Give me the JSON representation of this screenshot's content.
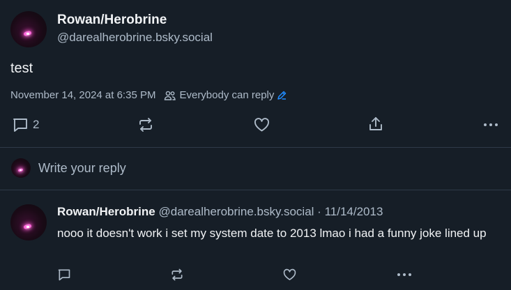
{
  "post": {
    "author_name": "Rowan/Herobrine",
    "author_handle": "@darealherobrine.bsky.social",
    "text": "test",
    "timestamp": "November 14, 2024 at 6:35 PM",
    "reply_setting": "Everybody can reply",
    "reply_count": "2"
  },
  "composer": {
    "placeholder": "Write your reply"
  },
  "reply": {
    "author_name": "Rowan/Herobrine",
    "author_handle": "@darealherobrine.bsky.social",
    "separator": "·",
    "date": "11/14/2013",
    "text": "nooo it doesn't work i set my system date to 2013 lmao i had a funny joke lined up"
  },
  "icons": {
    "reply": "comment-icon",
    "repost": "repost-icon",
    "like": "heart-icon",
    "share": "share-icon",
    "more": "more-icon",
    "people": "people-icon",
    "edit": "pencil-icon"
  },
  "colors": {
    "background": "#161e27",
    "text": "#f1f3f5",
    "secondary_text": "#aebbc9",
    "accent": "#208bfe",
    "divider": "#2e3a48"
  }
}
